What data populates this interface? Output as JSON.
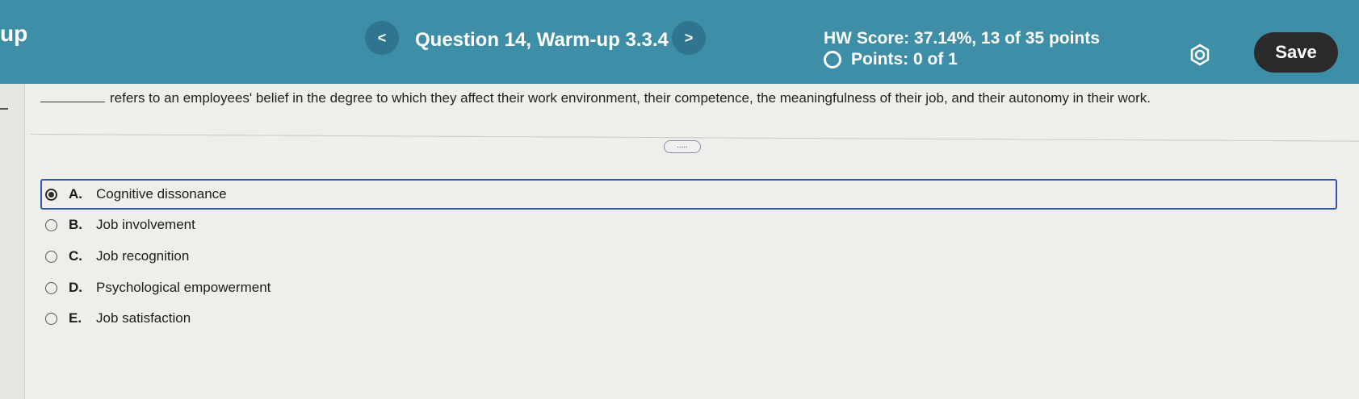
{
  "header": {
    "app_fragment": "up",
    "prev_label": "<",
    "next_label": ">",
    "question_title": "Question 14, Warm-up 3.3.4",
    "hw_score": "HW Score: 37.14%, 13 of 35 points",
    "points": "Points: 0 of 1",
    "save_label": "Save",
    "settings_icon": "gear-icon",
    "bar_color": "#3f8ea8"
  },
  "question": {
    "text": "refers to an employees' belief in the degree to which they affect their work environment, their competence, the meaningfulness of their job, and their autonomy in their work.",
    "more_label": "....."
  },
  "options": [
    {
      "letter": "A.",
      "text": "Cognitive dissonance",
      "selected": true
    },
    {
      "letter": "B.",
      "text": "Job involvement",
      "selected": false
    },
    {
      "letter": "C.",
      "text": "Job recognition",
      "selected": false
    },
    {
      "letter": "D.",
      "text": "Psychological empowerment",
      "selected": false
    },
    {
      "letter": "E.",
      "text": "Job satisfaction",
      "selected": false
    }
  ]
}
